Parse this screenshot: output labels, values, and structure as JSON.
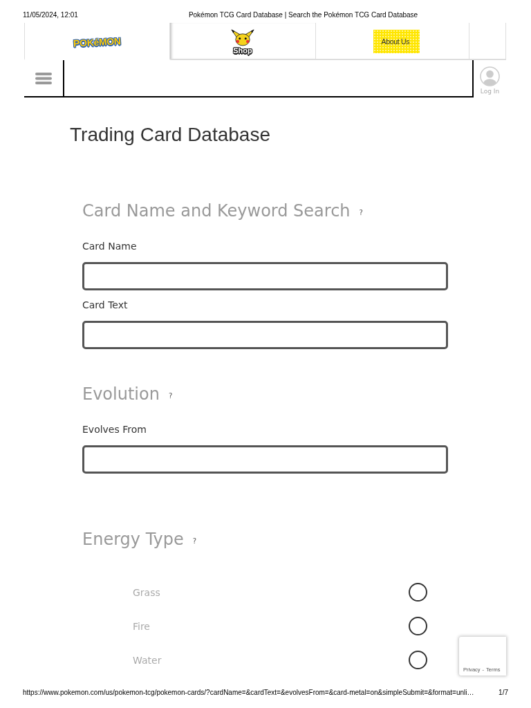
{
  "print_header": {
    "date": "11/05/2024, 12:01",
    "title": "Pokémon TCG Card Database | Search the Pokémon TCG Card Database"
  },
  "nav_tabs": [
    {
      "kind": "logo",
      "label": "POKéMON",
      "selected": true
    },
    {
      "kind": "shop",
      "label": "Shop",
      "selected": false
    },
    {
      "kind": "about",
      "label": "About Us",
      "selected": false
    },
    {
      "kind": "blank",
      "selected": false
    }
  ],
  "header": {
    "login": "Log In"
  },
  "page_title": "Trading Card Database",
  "sections": [
    {
      "kind": "fields",
      "heading": "Card Name and Keyword Search",
      "help": "?",
      "fields": [
        {
          "label": "Card Name"
        },
        {
          "label": "Card Text"
        }
      ]
    },
    {
      "kind": "fields",
      "heading": "Evolution",
      "help": "?",
      "fields": [
        {
          "label": "Evolves From"
        }
      ]
    },
    {
      "kind": "options",
      "heading": "Energy Type",
      "help": "?",
      "options": [
        {
          "label": "Grass",
          "checked": false
        },
        {
          "label": "Fire",
          "checked": false
        },
        {
          "label": "Water",
          "checked": false
        }
      ]
    }
  ],
  "recaptcha": {
    "links": [
      "Privacy",
      "Terms"
    ],
    "separator": "-"
  },
  "print_footer": {
    "url": "https://www.pokemon.com/us/pokemon-tcg/pokemon-cards/?cardName=&cardText=&evolvesFrom=&card-metal=on&simpleSubmit=&format=unli…",
    "page": "1/7"
  }
}
